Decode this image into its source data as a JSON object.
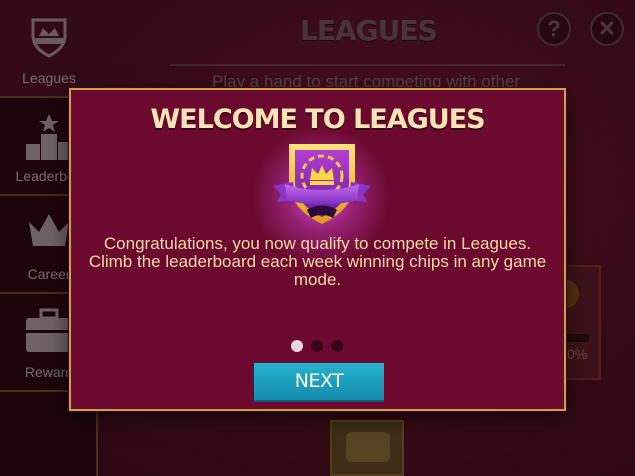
{
  "sidebar": {
    "items": [
      {
        "label": "Leagues",
        "icon": "leagues-shield-icon",
        "active": true
      },
      {
        "label": "Leaderboa",
        "icon": "leaderboard-podium-icon",
        "active": false
      },
      {
        "label": "Career",
        "icon": "crown-icon",
        "active": false
      },
      {
        "label": "Reward",
        "icon": "briefcase-icon",
        "active": false
      }
    ]
  },
  "header": {
    "title": "LEAGUES",
    "help_label": "?",
    "close_label": "✕",
    "subtitle": "Play a hand to start competing with other"
  },
  "background": {
    "reward_percent": "0%"
  },
  "modal": {
    "title": "WELCOME TO LEAGUES",
    "badge_icon": "leagues-crown-shield-icon",
    "body": "Congratulations, you now qualify to compete in Leagues. Climb the leaderboard each week winning chips in any game mode.",
    "pager": {
      "total": 3,
      "current": 1
    },
    "next_label": "NEXT"
  },
  "colors": {
    "modal_bg": "#6b0a2e",
    "modal_border": "#c9a24a",
    "title_text": "#fbe3b8",
    "body_text": "#f4d9a6",
    "next_button": "#1a9dbf"
  }
}
